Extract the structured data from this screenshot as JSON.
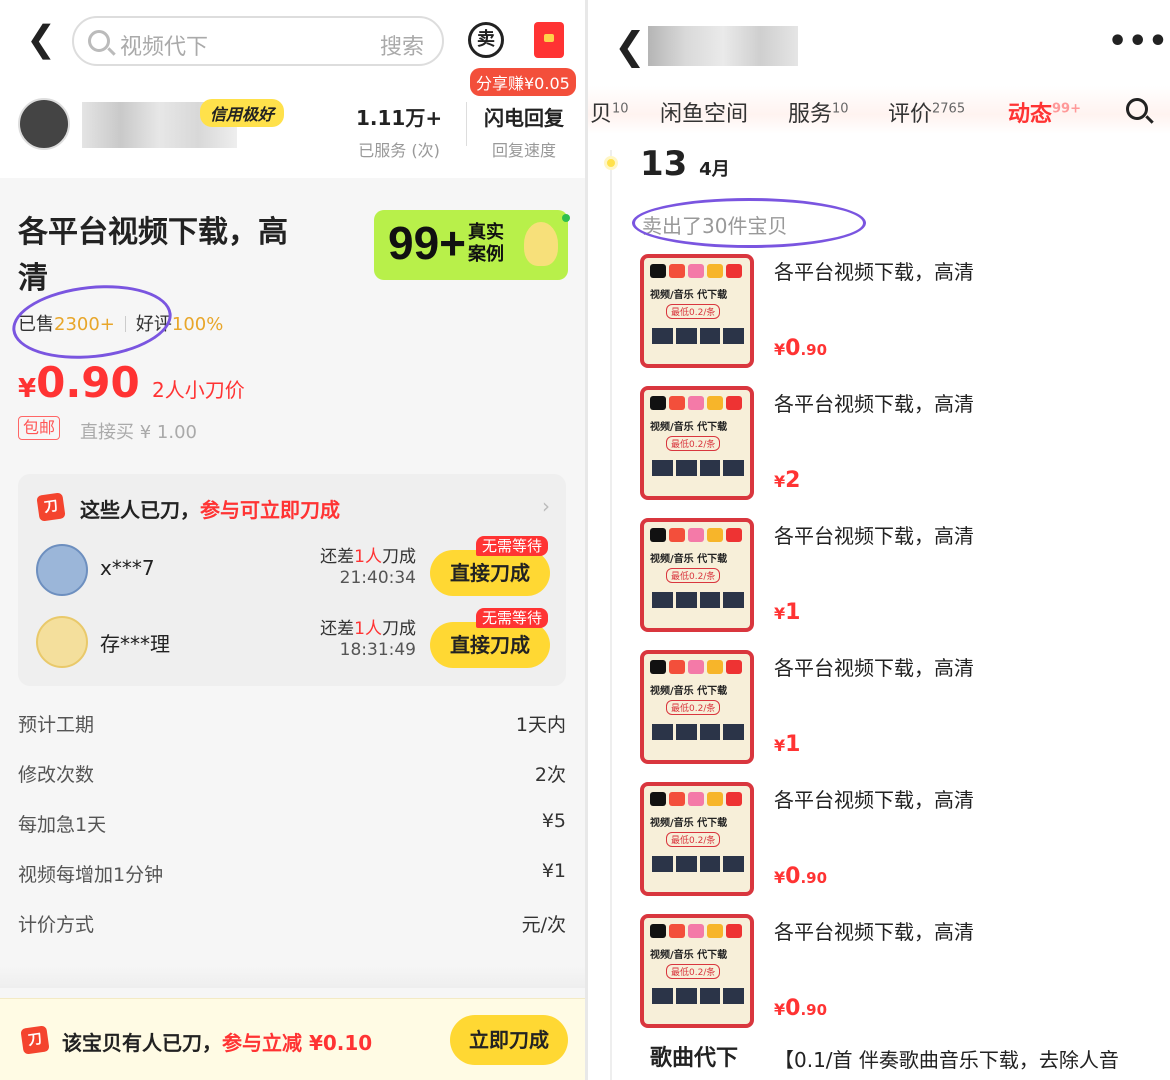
{
  "left": {
    "search": {
      "placeholder": "视频代下",
      "button": "搜索"
    },
    "sell_icon": "卖",
    "share_badge": "分享赚¥0.05",
    "seller": {
      "credit_badge": "信用极好"
    },
    "stats": [
      {
        "value": "1.11万+",
        "label": "已服务 (次)"
      },
      {
        "value": "闪电回复",
        "label": "回复速度"
      }
    ],
    "product": {
      "title": "各平台视频下载，高清",
      "case_banner": {
        "number": "99+",
        "text": "真实案例"
      },
      "sold_label": "已售",
      "sold_value": "2300+",
      "rating_label": "好评",
      "rating_value": "100%",
      "price_symbol": "¥",
      "price": "0.90",
      "price_note": "2人小刀价",
      "free_shipping": "包邮",
      "direct_buy": "直接买 ¥ 1.00"
    },
    "bargain": {
      "icon": "刀",
      "heading_black": "这些人已刀，",
      "heading_red": "参与可立即刀成",
      "rows": [
        {
          "name": "x***7",
          "need_prefix": "还差",
          "need_num": "1人",
          "need_suffix": "刀成",
          "time": "21:40:34",
          "tag": "无需等待",
          "button": "直接刀成"
        },
        {
          "name": "存***理",
          "need_prefix": "还差",
          "need_num": "1人",
          "need_suffix": "刀成",
          "time": "18:31:49",
          "tag": "无需等待",
          "button": "直接刀成"
        }
      ]
    },
    "specs": [
      {
        "key": "预计工期",
        "value": "1天内"
      },
      {
        "key": "修改次数",
        "value": "2次"
      },
      {
        "key": "每加急1天",
        "value": "¥5"
      },
      {
        "key": "视频每增加1分钟",
        "value": "¥1"
      },
      {
        "key": "计价方式",
        "value": "元/次"
      }
    ],
    "bottom": {
      "icon": "刀",
      "text_black": "该宝贝有人已刀，",
      "text_red": "参与立减 ¥0.10",
      "button": "立即刀成"
    }
  },
  "right": {
    "tabs": [
      {
        "label": "贝",
        "count": "10"
      },
      {
        "label": "闲鱼空间",
        "count": ""
      },
      {
        "label": "服务",
        "count": "10"
      },
      {
        "label": "评价",
        "count": "2765"
      },
      {
        "label": "动态",
        "count": "99+"
      }
    ],
    "date": {
      "day": "13",
      "month": "4月"
    },
    "sold_header": "卖出了30件宝贝",
    "items": [
      {
        "title": "各平台视频下载，高清",
        "price_int": "0",
        "price_dec": ".90"
      },
      {
        "title": "各平台视频下载，高清",
        "price_int": "2",
        "price_dec": ""
      },
      {
        "title": "各平台视频下载，高清",
        "price_int": "1",
        "price_dec": ""
      },
      {
        "title": "各平台视频下载，高清",
        "price_int": "1",
        "price_dec": ""
      },
      {
        "title": "各平台视频下载，高清",
        "price_int": "0",
        "price_dec": ".90"
      },
      {
        "title": "各平台视频下载，高清",
        "price_int": "0",
        "price_dec": ".90"
      }
    ],
    "thumb": {
      "line1": "视频/音乐 代下载",
      "line2": "最低0.2/条"
    },
    "last_item": {
      "title": "歌曲代下",
      "desc": "【0.1/首 伴奏歌曲音乐下载，去除人音"
    }
  },
  "colors": {
    "price_red": "#f33333",
    "accent_yellow": "#ffd833",
    "annotation_purple": "#7a55e0",
    "credit_yellow": "#ffe14b"
  }
}
